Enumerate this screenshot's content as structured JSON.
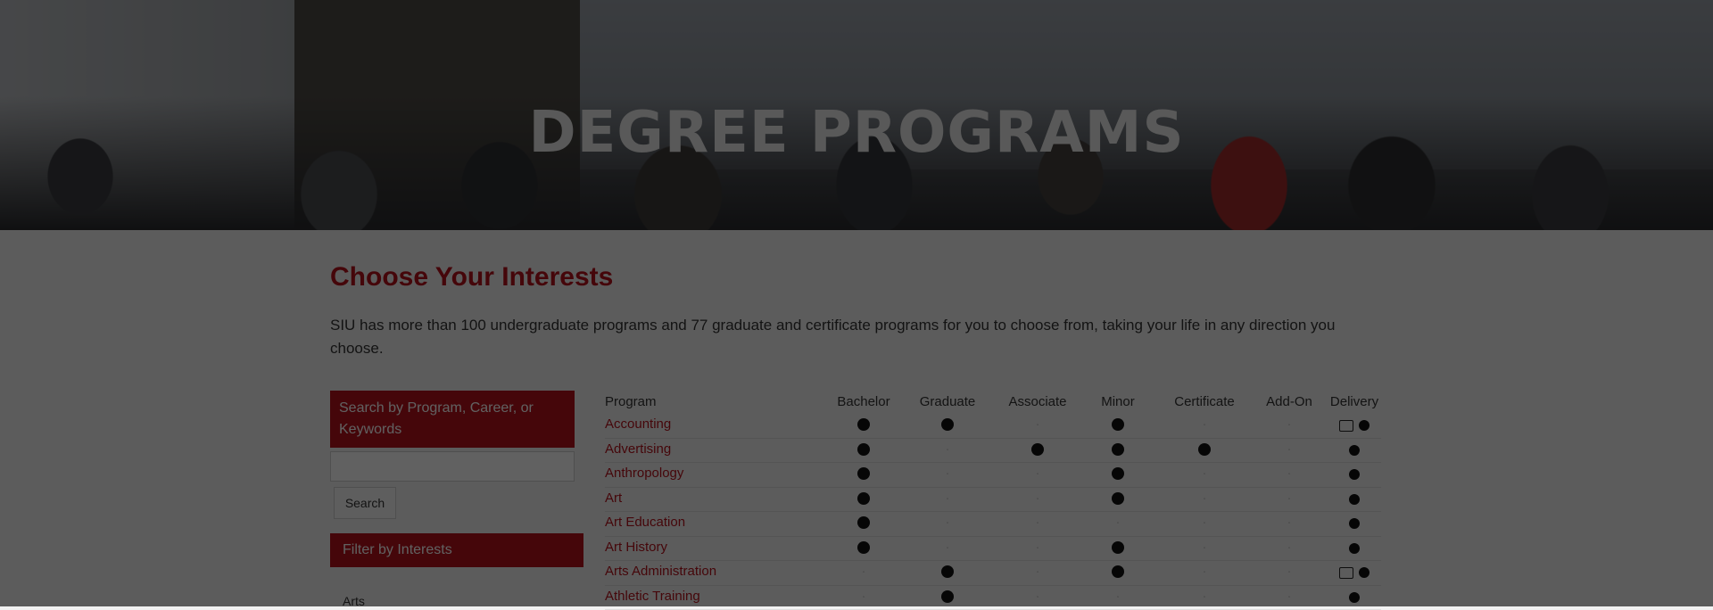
{
  "hero": {
    "title": "DEGREE PROGRAMS"
  },
  "page": {
    "title": "Choose Your Interests",
    "intro": "SIU has more than 100 undergraduate programs and 77 graduate and certificate programs for you to choose from, taking your life in any direction you choose."
  },
  "search": {
    "header": "Search by Program, Career, or Keywords",
    "placeholder": "",
    "button": "Search"
  },
  "filter": {
    "header": "Filter by Interests",
    "first_item": "Arts"
  },
  "table": {
    "headers": [
      "Program",
      "Bachelor",
      "Graduate",
      "Associate",
      "Minor",
      "Certificate",
      "Add-On",
      "Delivery"
    ],
    "rows": [
      {
        "program": "Accounting",
        "cols": [
          true,
          true,
          false,
          true,
          false,
          false
        ],
        "delivery": "both"
      },
      {
        "program": "Advertising",
        "cols": [
          true,
          false,
          true,
          true,
          true,
          false
        ],
        "delivery": "dot"
      },
      {
        "program": "Anthropology",
        "cols": [
          true,
          false,
          false,
          true,
          false,
          false
        ],
        "delivery": "dot"
      },
      {
        "program": "Art",
        "cols": [
          true,
          false,
          false,
          true,
          false,
          false
        ],
        "delivery": "dot"
      },
      {
        "program": "Art Education",
        "cols": [
          true,
          false,
          false,
          false,
          false,
          false
        ],
        "delivery": "dot"
      },
      {
        "program": "Art History",
        "cols": [
          true,
          false,
          false,
          true,
          false,
          false
        ],
        "delivery": "dot"
      },
      {
        "program": "Arts Administration",
        "cols": [
          false,
          true,
          false,
          true,
          false,
          false
        ],
        "delivery": "both"
      },
      {
        "program": "Athletic Training",
        "cols": [
          false,
          true,
          false,
          false,
          false,
          false
        ],
        "delivery": "dot"
      }
    ]
  },
  "colors": {
    "accent": "#b5121b"
  },
  "icons": {
    "online": "monitor-icon",
    "campus": "dot-icon"
  }
}
